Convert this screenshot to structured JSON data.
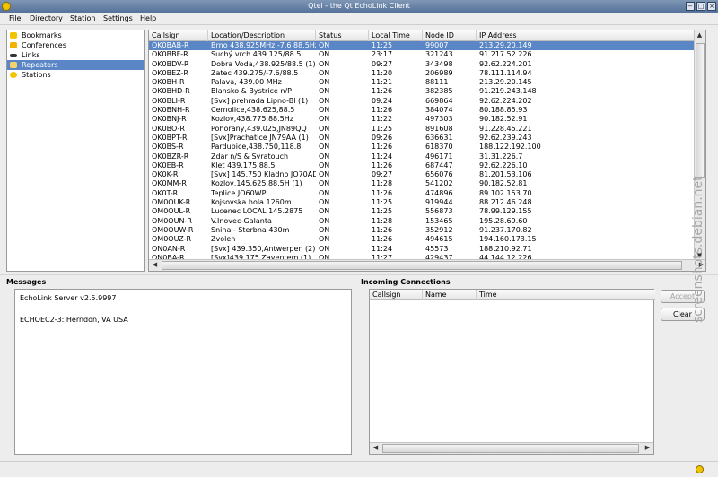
{
  "window": {
    "title": "Qtel - the Qt EchoLink Client",
    "minimize_glyph": "−",
    "maximize_glyph": "□",
    "close_glyph": "×"
  },
  "menubar": {
    "items": [
      {
        "label": "File"
      },
      {
        "label": "Directory"
      },
      {
        "label": "Station"
      },
      {
        "label": "Settings"
      },
      {
        "label": "Help"
      }
    ]
  },
  "nav": {
    "items": [
      {
        "label": "Bookmarks",
        "icon": "star-icon"
      },
      {
        "label": "Conferences",
        "icon": "conference-icon"
      },
      {
        "label": "Links",
        "icon": "link-icon"
      },
      {
        "label": "Repeaters",
        "icon": "repeater-icon",
        "selected": true
      },
      {
        "label": "Stations",
        "icon": "station-icon"
      }
    ]
  },
  "table": {
    "columns": [
      "Callsign",
      "Location/Description",
      "Status",
      "Local Time",
      "Node ID",
      "IP Address"
    ],
    "rows": [
      [
        "OK0BAB-R",
        "Brno 438.925MHz -7.6 88.5Hz",
        "ON",
        "11:25",
        "99007",
        "213.29.20.149"
      ],
      [
        "OK0BBF-R",
        "Suchý vrch 439.125/88.5",
        "ON",
        "23:17",
        "321243",
        "91.217.52.226"
      ],
      [
        "OK0BDV-R",
        "Dobra Voda,438.925/88.5 (1)",
        "ON",
        "09:27",
        "343498",
        "92.62.224.201"
      ],
      [
        "OK0BEZ-R",
        "Zatec 439.275/-7.6/88.5",
        "ON",
        "11:20",
        "206989",
        "78.111.114.94"
      ],
      [
        "OK0BH-R",
        "Palava, 439.00 MHz",
        "ON",
        "11:21",
        "88111",
        "213.29.20.145"
      ],
      [
        "OK0BHD-R",
        "Blansko & Bystrice n/P",
        "ON",
        "11:26",
        "382385",
        "91.219.243.148"
      ],
      [
        "OK0BLI-R",
        "[Svx] prehrada Lipno-Bl (1)",
        "ON",
        "09:24",
        "669864",
        "92.62.224.202"
      ],
      [
        "OK0BNH-R",
        "Cernolice,438.625,88.5",
        "ON",
        "11:26",
        "384074",
        "80.188.85.93"
      ],
      [
        "OK0BNJ-R",
        "Kozlov,438.775,88.5Hz",
        "ON",
        "11:22",
        "497303",
        "90.182.52.91"
      ],
      [
        "OK0BO-R",
        "Pohorany,439.025,JN89QQ",
        "ON",
        "11:25",
        "891608",
        "91.228.45.221"
      ],
      [
        "OK0BPT-R",
        "[Svx]Prachatice JN79AA  (1)",
        "ON",
        "09:26",
        "636631",
        "92.62.239.243"
      ],
      [
        "OK0BS-R",
        "Pardubice,438.750,118.8",
        "ON",
        "11:26",
        "618370",
        "188.122.192.100"
      ],
      [
        "OK0BZR-R",
        "Zdar n/S & Svratouch",
        "ON",
        "11:24",
        "496171",
        "31.31.226.7"
      ],
      [
        "OK0EB-R",
        "Klet 439.175,88.5",
        "ON",
        "11:26",
        "687447",
        "92.62.226.10"
      ],
      [
        "OK0K-R",
        "[Svx] 145.750 Kladno JO70AD",
        "ON",
        "09:27",
        "656076",
        "81.201.53.106"
      ],
      [
        "OK0MM-R",
        "Kozlov,145.625,88.5H (1)",
        "ON",
        "11:28",
        "541202",
        "90.182.52.81"
      ],
      [
        "OK0T-R",
        "Teplice JO60WP",
        "ON",
        "11:26",
        "474896",
        "89.102.153.70"
      ],
      [
        "OM0OUK-R",
        "Kojsovska hola 1260m",
        "ON",
        "11:25",
        "919944",
        "88.212.46.248"
      ],
      [
        "OM0OUL-R",
        "Lucenec LOCAL 145.2875",
        "ON",
        "11:25",
        "556873",
        "78.99.129.155"
      ],
      [
        "OM0OUN-R",
        "V.Inovec-Galanta",
        "ON",
        "11:28",
        "153465",
        "195.28.69.60"
      ],
      [
        "OM0OUW-R",
        "Snina - Sterbna 430m",
        "ON",
        "11:26",
        "352912",
        "91.237.170.82"
      ],
      [
        "OM0OUZ-R",
        "Zvolen",
        "ON",
        "11:26",
        "494615",
        "194.160.173.15"
      ],
      [
        "ON0AN-R",
        "[Svx] 439.350,Antwerpen (2)",
        "ON",
        "11:24",
        "45573",
        "188.210.92.71"
      ],
      [
        "ON0BA-R",
        "[Svx]439.175,Zaventem   (1)",
        "ON",
        "11:27",
        "429437",
        "44.144.12.226"
      ]
    ]
  },
  "messages": {
    "title": "Messages",
    "lines": [
      "EchoLink Server v2.5.9997",
      "",
      "ECHOEC2-3: Herndon, VA USA"
    ]
  },
  "incoming": {
    "title": "Incoming Connections",
    "columns": [
      "Callsign",
      "Name",
      "Time"
    ],
    "accept_label": "Accept",
    "clear_label": "Clear"
  },
  "watermark": "screenshots.debian.net"
}
